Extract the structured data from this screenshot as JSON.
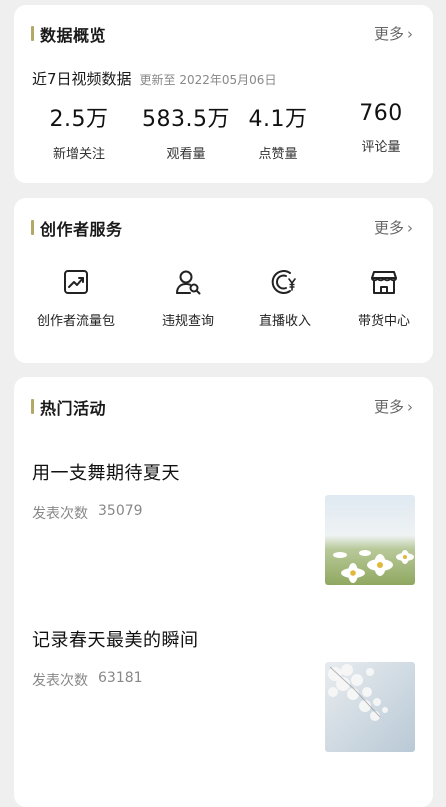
{
  "overview": {
    "title": "数据概览",
    "more_label": "更多",
    "subtitle": "近7日视频数据",
    "updated": "更新至 2022年05月06日",
    "stats": [
      {
        "value": "2.5万",
        "label": "新增关注"
      },
      {
        "value": "583.5万",
        "label": "观看量"
      },
      {
        "value": "4.1万",
        "label": "点赞量"
      },
      {
        "value": "760",
        "label": "评论量"
      }
    ]
  },
  "services": {
    "title": "创作者服务",
    "more_label": "更多",
    "items": [
      {
        "label": "创作者流量包",
        "icon": "trend-chart-icon"
      },
      {
        "label": "违规查询",
        "icon": "user-search-icon"
      },
      {
        "label": "直播收入",
        "icon": "yuan-coin-icon"
      },
      {
        "label": "带货中心",
        "icon": "store-icon"
      }
    ]
  },
  "activities": {
    "title": "热门活动",
    "more_label": "更多",
    "items": [
      {
        "title": "用一支舞期待夏天",
        "meta_label": "发表次数",
        "count": "35079",
        "thumb": "daisy-field-image"
      },
      {
        "title": "记录春天最美的瞬间",
        "meta_label": "发表次数",
        "count": "63181",
        "thumb": "white-blossom-image"
      }
    ]
  },
  "colors": {
    "accent_bar": "#b3a866",
    "background": "#efefef",
    "card": "#ffffff"
  }
}
